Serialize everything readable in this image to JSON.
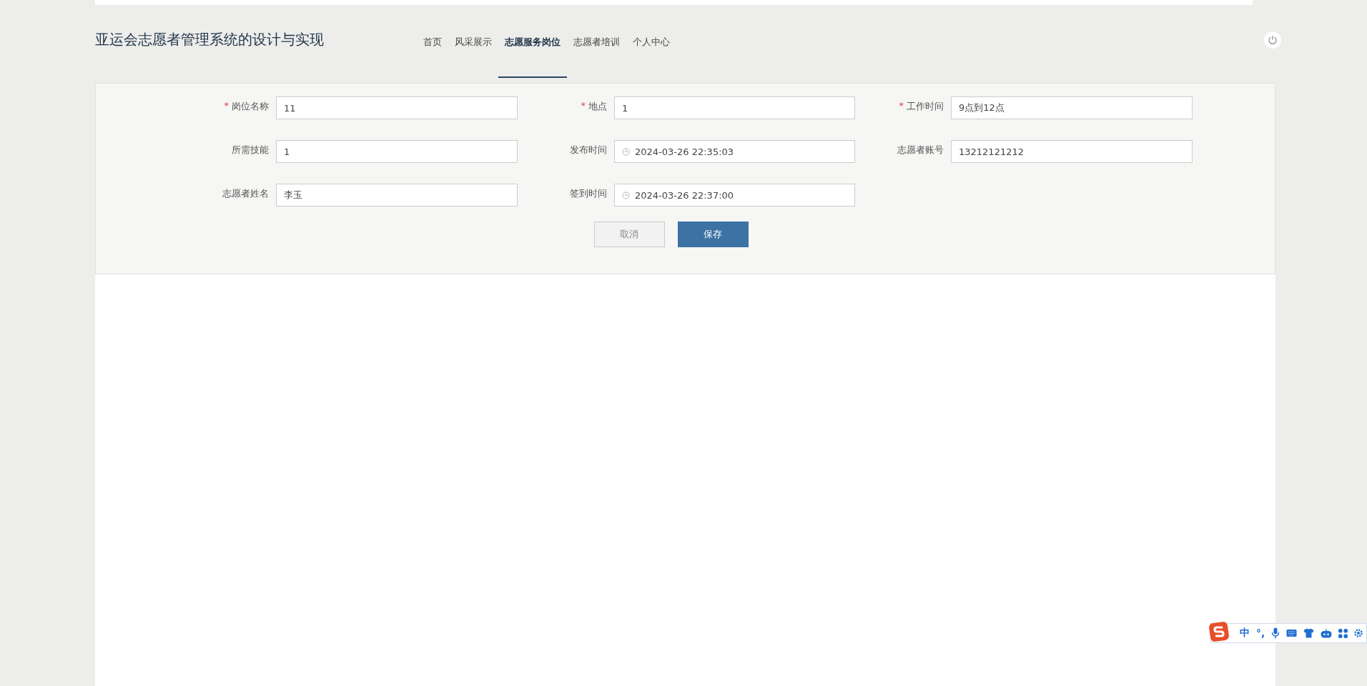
{
  "header": {
    "title": "亚运会志愿者管理系统的设计与实现",
    "nav": [
      {
        "label": "首页",
        "selected": false
      },
      {
        "label": "风采展示",
        "selected": false
      },
      {
        "label": "志愿服务岗位",
        "selected": true
      },
      {
        "label": "志愿者培训",
        "selected": false
      },
      {
        "label": "个人中心",
        "selected": false
      }
    ]
  },
  "form": {
    "fields": [
      {
        "required_mark": "*",
        "label": "岗位名称",
        "kind": "text",
        "value": "11"
      },
      {
        "required_mark": "*",
        "label": "地点",
        "kind": "text",
        "value": "1"
      },
      {
        "required_mark": "*",
        "label": "工作时间",
        "kind": "text",
        "value": "9点到12点"
      },
      {
        "label": "所需技能",
        "kind": "text",
        "value": "1"
      },
      {
        "label": "发布时间",
        "kind": "datetime",
        "value": "2024-03-26 22:35:03"
      },
      {
        "label": "志愿者账号",
        "kind": "text",
        "value": "13212121212"
      },
      {
        "label": "志愿者姓名",
        "kind": "text",
        "value": "李玉"
      },
      {
        "label": "签到时间",
        "kind": "datetime",
        "value": "2024-03-26 22:37:00"
      }
    ],
    "buttons": [
      {
        "label": "取消",
        "kind": "secondary"
      },
      {
        "label": "保存",
        "kind": "primary"
      }
    ]
  },
  "ime_toolbar": {
    "mode": "中",
    "punctuation": "°,"
  }
}
